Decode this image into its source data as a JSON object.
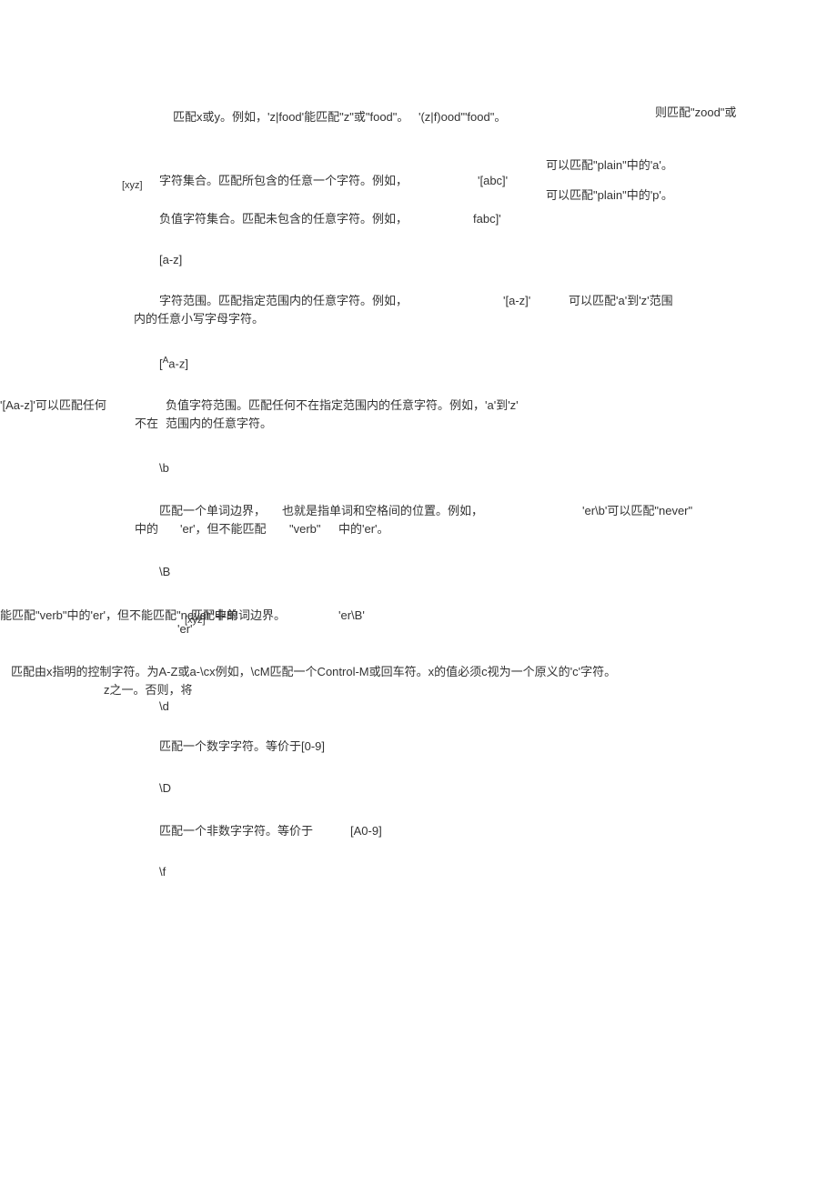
{
  "fragments": {
    "r1a": "匹配x或y。例如，'z|food'能匹配\"z\"或\"food\"。",
    "r1b": "'(z|f)ood'\"food\"。",
    "r1c": "则匹配\"zood\"或",
    "r2a": "[xyz]",
    "r2b": "字符集合。匹配所包含的任意一个字符。例如，",
    "r2c": "'[abc]'",
    "r2d": "可以匹配\"plain\"中的'a'。",
    "r2e": "可以匹配\"plain\"中的'p'。",
    "r3a": "负值字符集合。匹配未包含的任意字符。例如，",
    "r3b": "fabc]'",
    "r4a": "[a-z]",
    "r5a": "字符范围。匹配指定范围内的任意字符。例如，",
    "r5b": "'[a-z]'",
    "r5c": "可以匹配'a'到'z'范围",
    "r5d": "内的任意小写字母字符。",
    "r6a": "[Aa-z]",
    "r7a": "'[Aa-z]'可以匹配任何",
    "r7b": "不在",
    "r7c": "负值字符范围。匹配任何不在指定范围内的任意字符。例如，'a'到'z'",
    "r7d": "范围内的任意字符。",
    "r8a": "\\b",
    "r9a": "匹配一个单词边界，",
    "r9b": "也就是指单词和空格间的位置。例如，",
    "r9c": "'er\\b'可以匹配\"never\"",
    "r9d": "中的",
    "r9e": "'er'，但不能匹配",
    "r9f": "\"verb\"",
    "r9g": "中的'er'。",
    "r10a": "\\B",
    "r11a": "能匹配\"verb\"中的'er'，但不能匹配\"never\"中的",
    "r11b": "匹配非单词边界。",
    "r11c": "'er\\B'",
    "r11d": "'er'",
    "r11e": "[xyz]",
    "r12a": "匹配由x指明的控制字符。为A-Z或a-\\cx例如，\\cM匹配一个Control-M或回车符。x的值必须c视为一个原义的'c'字符。",
    "r12b": "z之一。否则，将",
    "r13a": "\\d",
    "r14a": "匹配一个数字字符。等价于[0-9]",
    "r15a": "\\D",
    "r16a": "匹配一个非数字字符。等价于",
    "r16b": "[A0-9]",
    "r17a": "\\f"
  }
}
